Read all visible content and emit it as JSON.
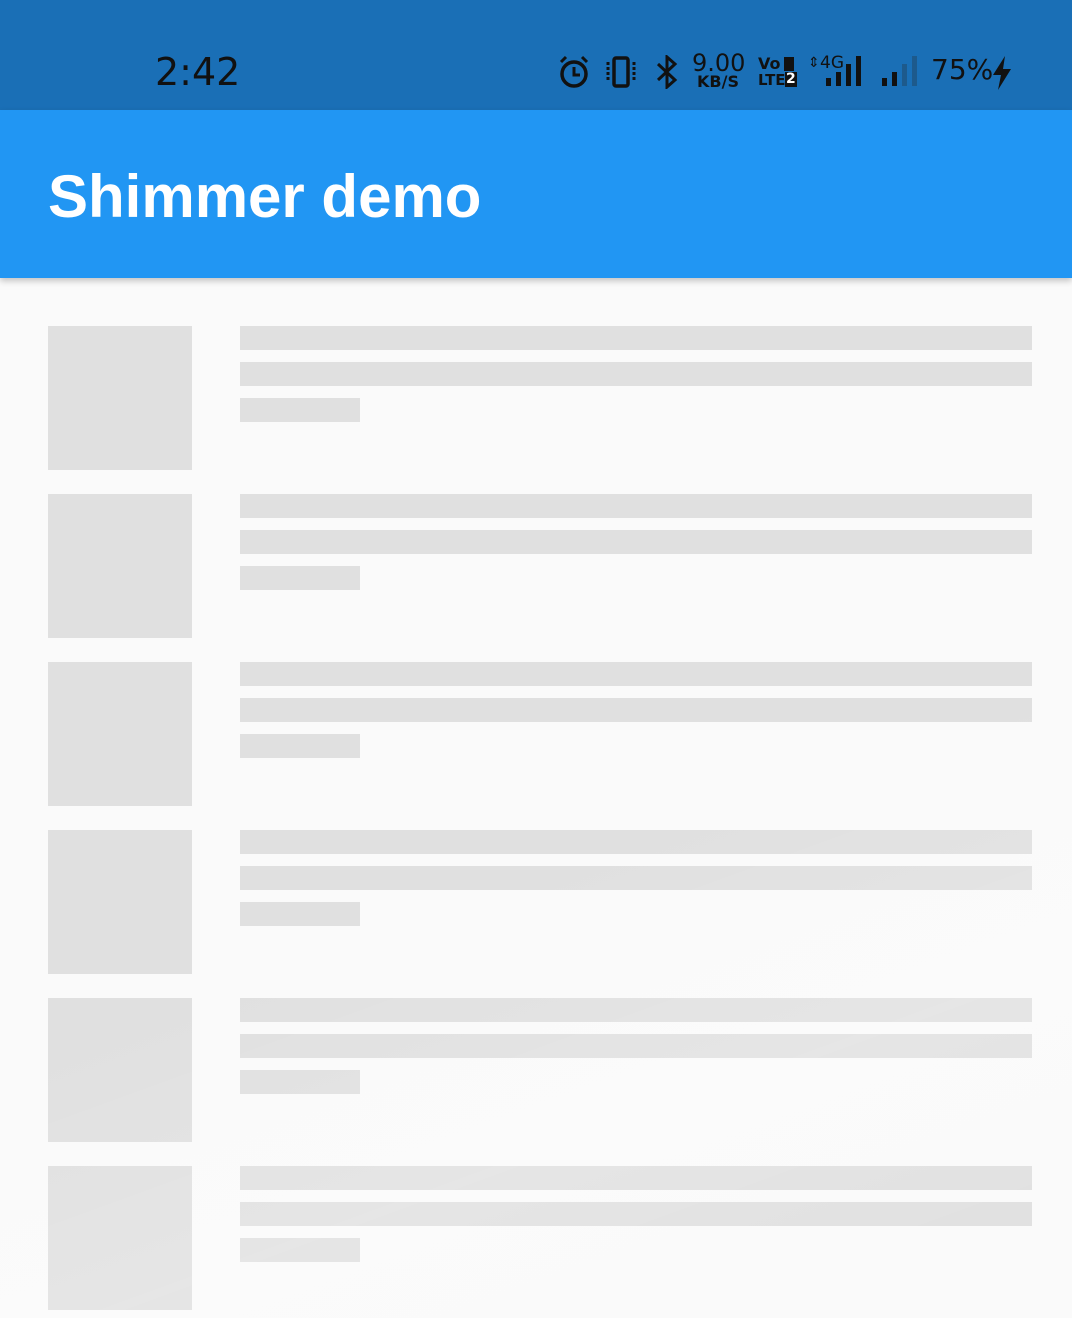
{
  "status_bar": {
    "time": "2:42",
    "net_speed_value": "9.00",
    "net_speed_unit": "KB/S",
    "volte_top": "Vo",
    "volte_bottom": "LTE",
    "sim_number": "2",
    "network_type": "4G",
    "battery_percent": "75%",
    "icons": [
      "alarm-icon",
      "vibrate-icon",
      "bluetooth-icon",
      "signal-icon",
      "battery-charging-icon"
    ],
    "background_color": "#1a6fb6"
  },
  "app_bar": {
    "title": "Shimmer demo",
    "background_color": "#2196f3"
  },
  "list": {
    "placeholder_color": "#e0e0e0",
    "background_color": "#fafafa",
    "items": [
      {
        "type": "skeleton"
      },
      {
        "type": "skeleton"
      },
      {
        "type": "skeleton"
      },
      {
        "type": "skeleton"
      },
      {
        "type": "skeleton"
      },
      {
        "type": "skeleton"
      }
    ]
  }
}
